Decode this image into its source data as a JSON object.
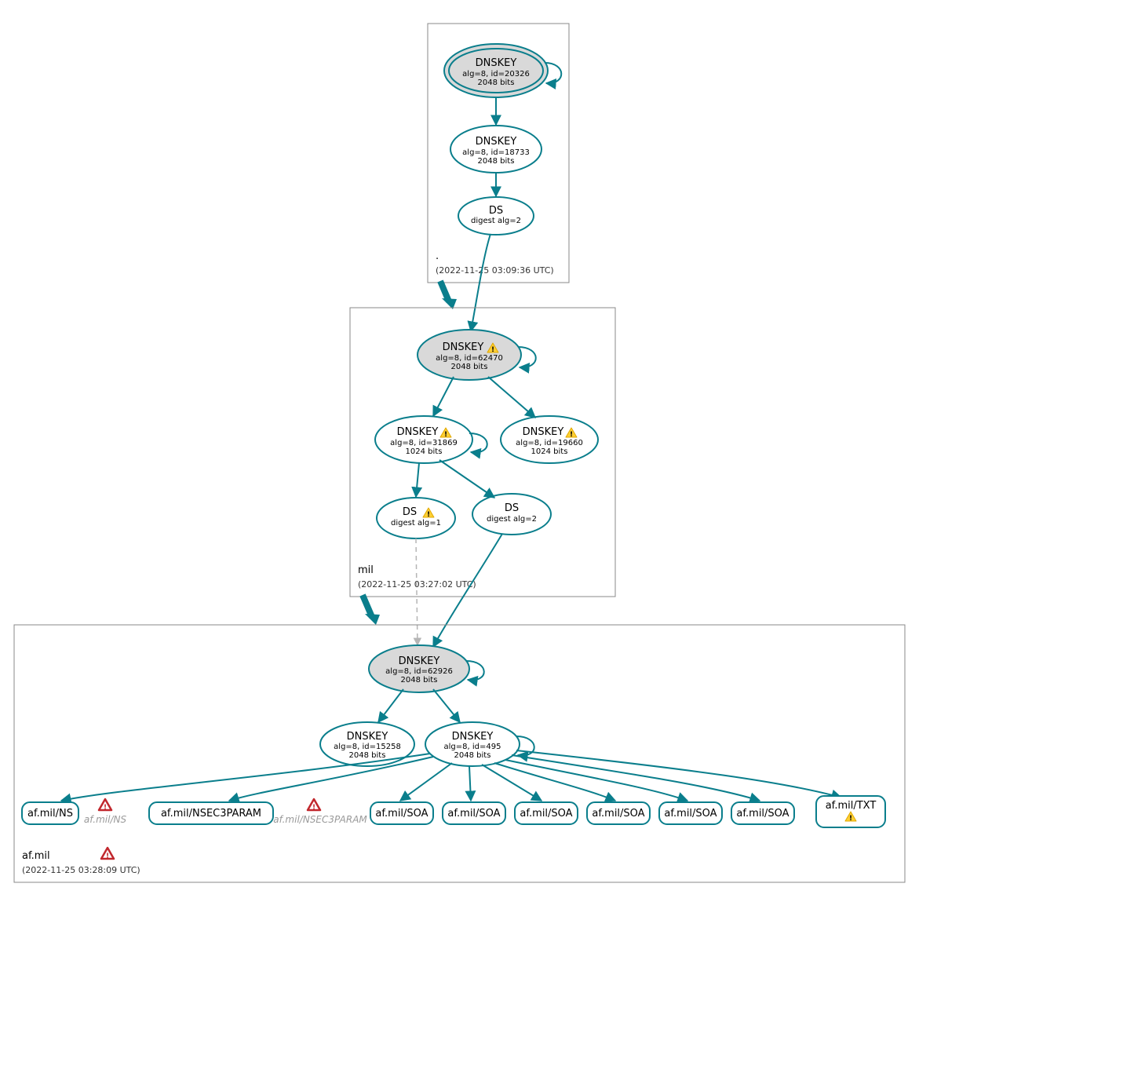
{
  "zones": {
    "root": {
      "name": ".",
      "timestamp": "(2022-11-25 03:09:36 UTC)"
    },
    "mil": {
      "name": "mil",
      "timestamp": "(2022-11-25 03:27:02 UTC)"
    },
    "afmil": {
      "name": "af.mil",
      "timestamp": "(2022-11-25 03:28:09 UTC)"
    }
  },
  "nodes": {
    "root_ksk": {
      "title": "DNSKEY",
      "l1": "alg=8, id=20326",
      "l2": "2048 bits"
    },
    "root_zsk": {
      "title": "DNSKEY",
      "l1": "alg=8, id=18733",
      "l2": "2048 bits"
    },
    "root_ds": {
      "title": "DS",
      "l1": "digest alg=2",
      "l2": ""
    },
    "mil_ksk": {
      "title": "DNSKEY",
      "l1": "alg=8, id=62470",
      "l2": "2048 bits"
    },
    "mil_zsk1": {
      "title": "DNSKEY",
      "l1": "alg=8, id=31869",
      "l2": "1024 bits"
    },
    "mil_zsk2": {
      "title": "DNSKEY",
      "l1": "alg=8, id=19660",
      "l2": "1024 bits"
    },
    "mil_ds1": {
      "title": "DS",
      "l1": "digest alg=1",
      "l2": ""
    },
    "mil_ds2": {
      "title": "DS",
      "l1": "digest alg=2",
      "l2": ""
    },
    "af_ksk": {
      "title": "DNSKEY",
      "l1": "alg=8, id=62926",
      "l2": "2048 bits"
    },
    "af_zsk1": {
      "title": "DNSKEY",
      "l1": "alg=8, id=15258",
      "l2": "2048 bits"
    },
    "af_zsk2": {
      "title": "DNSKEY",
      "l1": "alg=8, id=495",
      "l2": "2048 bits"
    },
    "rr_ns": {
      "label": "af.mil/NS"
    },
    "rr_ns_w": {
      "label": "af.mil/NS"
    },
    "rr_n3": {
      "label": "af.mil/NSEC3PARAM"
    },
    "rr_n3_w": {
      "label": "af.mil/NSEC3PARAM"
    },
    "rr_soa1": {
      "label": "af.mil/SOA"
    },
    "rr_soa2": {
      "label": "af.mil/SOA"
    },
    "rr_soa3": {
      "label": "af.mil/SOA"
    },
    "rr_soa4": {
      "label": "af.mil/SOA"
    },
    "rr_soa5": {
      "label": "af.mil/SOA"
    },
    "rr_soa6": {
      "label": "af.mil/SOA"
    },
    "rr_txt": {
      "label": "af.mil/TXT"
    }
  }
}
